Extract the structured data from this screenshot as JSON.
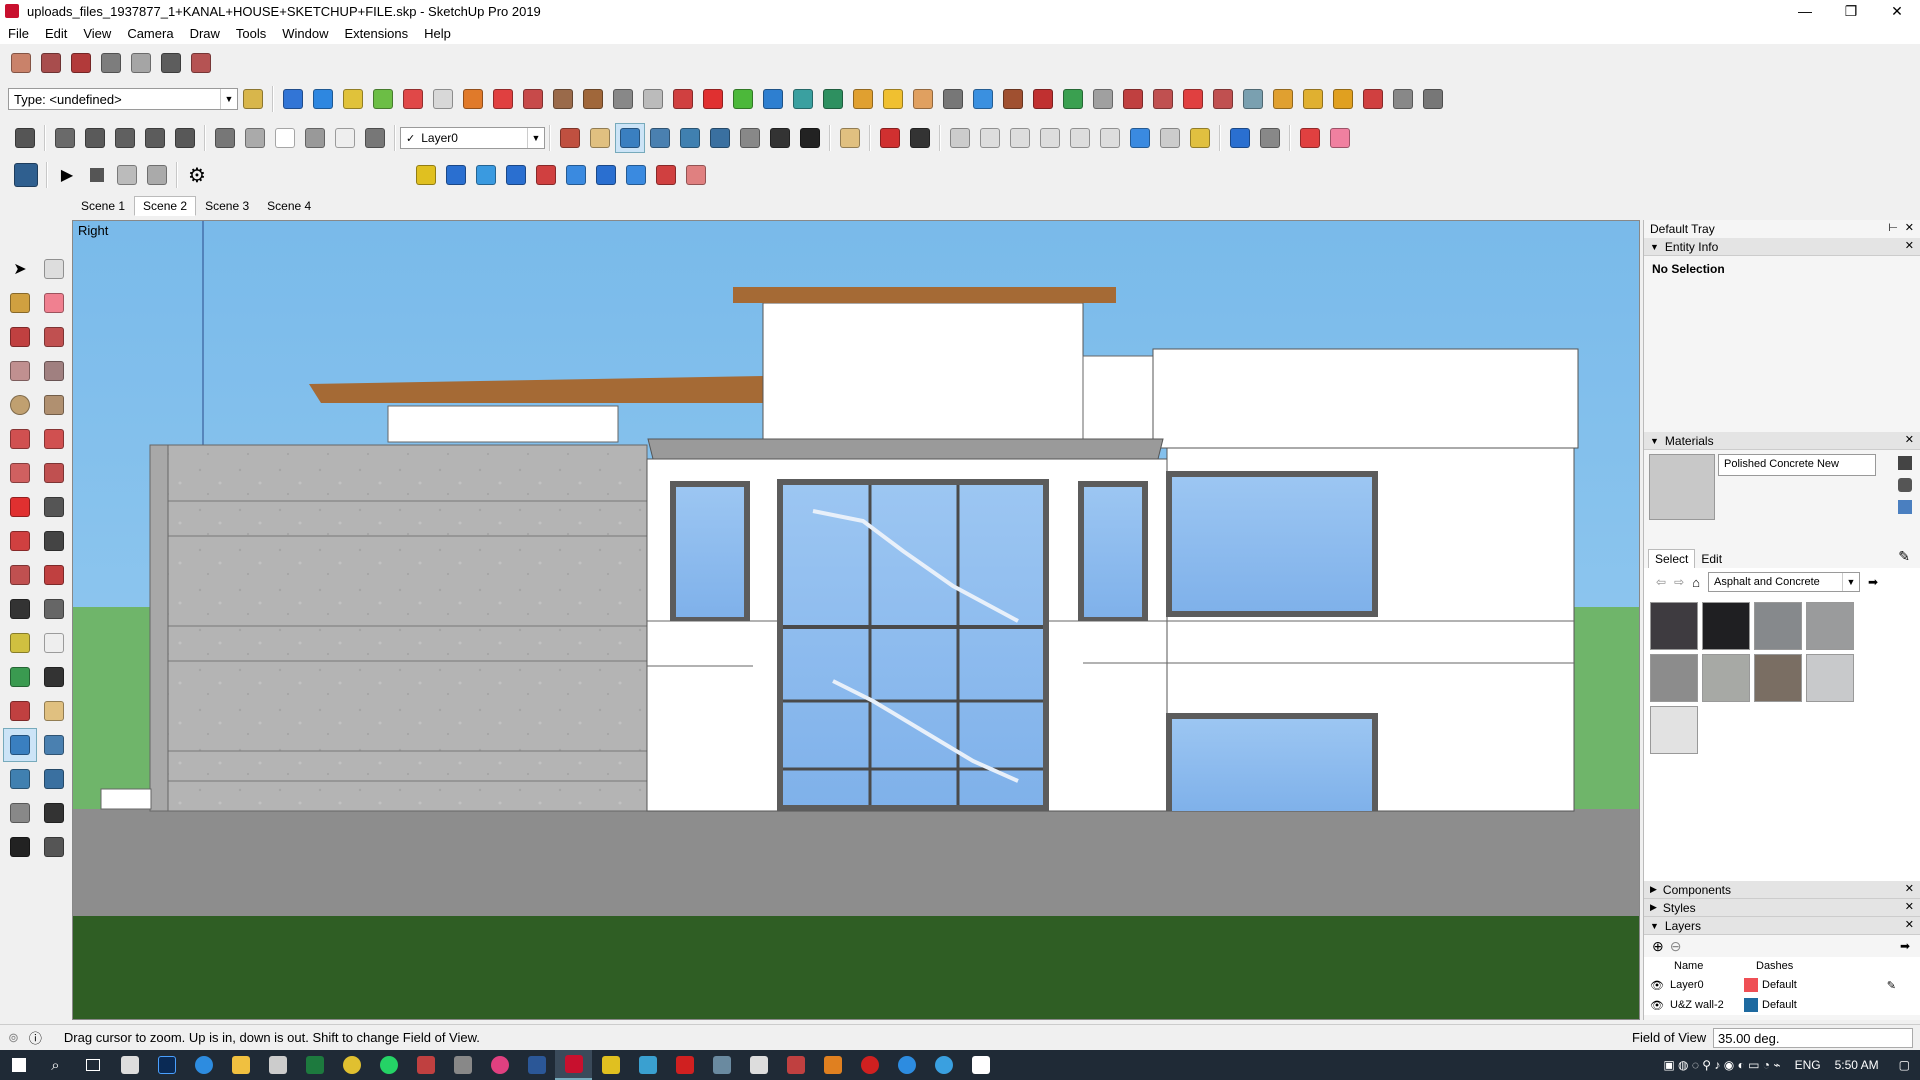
{
  "window": {
    "title": "uploads_files_1937877_1+KANAL+HOUSE+SKETCHUP+FILE.skp - SketchUp Pro 2019",
    "minimize": "—",
    "restore": "❐",
    "close": "✕"
  },
  "menu": [
    "File",
    "Edit",
    "View",
    "Camera",
    "Draw",
    "Tools",
    "Window",
    "Extensions",
    "Help"
  ],
  "toolbar": {
    "type_dropdown": "Type: <undefined>",
    "layer_dropdown": "Layer0",
    "layer_check": "✓"
  },
  "scenes": [
    "Scene 1",
    "Scene 2",
    "Scene 3",
    "Scene 4"
  ],
  "active_scene_index": 1,
  "viewport": {
    "view_label": "Right"
  },
  "tray": {
    "title": "Default Tray",
    "pin": "⊢",
    "close": "✕",
    "entity_info": {
      "header": "Entity Info",
      "selection": "No Selection"
    },
    "materials": {
      "header": "Materials",
      "current_name": "Polished Concrete New",
      "tab_select": "Select",
      "tab_edit": "Edit",
      "library": "Asphalt and Concrete",
      "swatch_colors": [
        "#3e3b40",
        "#1f1f22",
        "#86898c",
        "#9a9b9c",
        "#8c8c8c",
        "#a7a9a5",
        "#7a6e63",
        "#c8c9cb",
        "#e2e2e2"
      ]
    },
    "components_header": "Components",
    "styles_header": "Styles",
    "layers": {
      "header": "Layers",
      "col_name": "Name",
      "col_dashes": "Dashes",
      "rows": [
        {
          "name": "Layer0",
          "color": "#ef4f55",
          "dashes": "Default"
        },
        {
          "name": "U&Z wall-2",
          "color": "#1e6aa0",
          "dashes": "Default"
        }
      ]
    }
  },
  "status": {
    "message": "Drag cursor to zoom.  Up is in, down is out. Shift to change Field of View.",
    "measure_label": "Field of View",
    "measure_value": "35.00 deg."
  },
  "taskbar": {
    "lang": "ENG",
    "time": "5:50 AM"
  },
  "colors": {
    "sky": "#7fbfec",
    "ground": "#8c8c8c",
    "grass": "#2d5a20",
    "accent": "#c8102e"
  }
}
